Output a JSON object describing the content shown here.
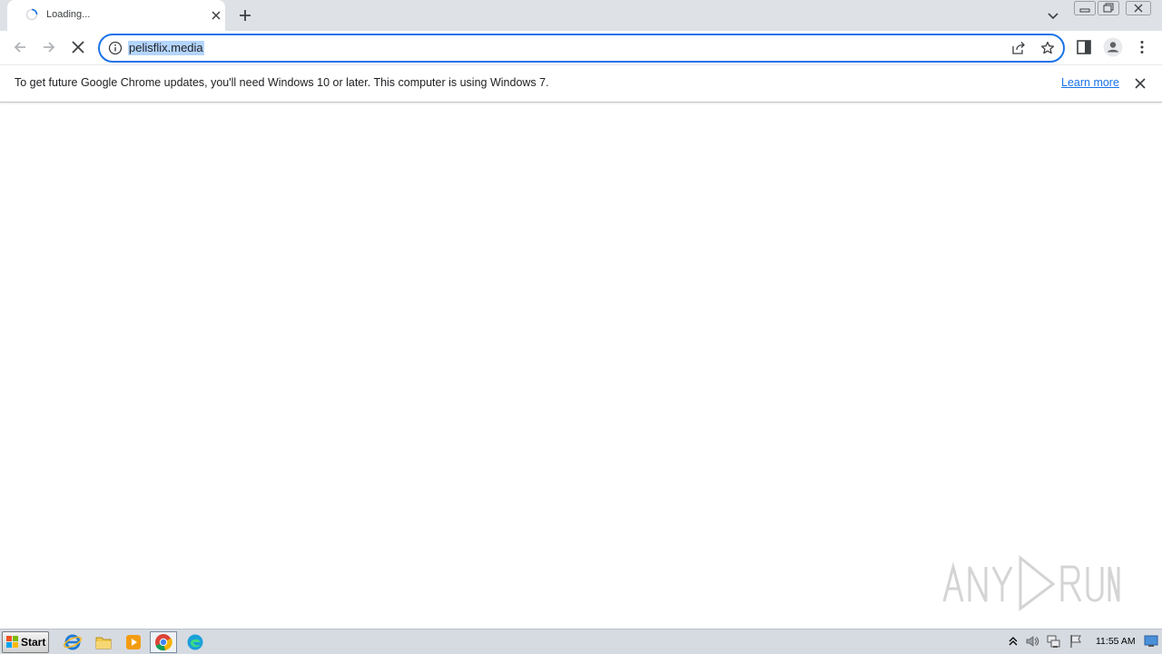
{
  "browser": {
    "tab": {
      "title": "Loading...",
      "spinner_icon": "loading-spinner-icon",
      "close_icon": "close-icon"
    },
    "new_tab_icon": "plus-icon",
    "tab_search_icon": "chevron-down-icon",
    "window_controls": [
      "minimize-icon",
      "restore-icon",
      "close-icon"
    ]
  },
  "toolbar": {
    "back_icon": "arrow-left-icon",
    "forward_icon": "arrow-right-icon",
    "stop_icon": "stop-loading-icon",
    "omnibox": {
      "url": "pelisflix.media",
      "info_icon": "info-icon",
      "share_icon": "share-icon",
      "bookmark_icon": "star-icon"
    },
    "side_panel_icon": "side-panel-icon",
    "profile_icon": "profile-icon",
    "menu_icon": "kebab-menu-icon"
  },
  "infobar": {
    "message": "To get future Google Chrome updates, you'll need Windows 10 or later. This computer is using Windows 7.",
    "link_label": "Learn more",
    "close_icon": "close-icon"
  },
  "watermark": {
    "text": "ANY RUN"
  },
  "taskbar": {
    "start_label": "Start",
    "apps": [
      "internet-explorer-icon",
      "folder-icon",
      "media-player-icon",
      "chrome-icon",
      "edge-icon"
    ],
    "tray_icons": [
      "show-hidden-icons-icon",
      "volume-icon",
      "network-icon",
      "action-center-flag-icon"
    ],
    "clock": "11:55 AM"
  },
  "colors": {
    "accent": "#1a73e8",
    "tabstrip": "#dee1e6",
    "url_selection": "#b4d5fe",
    "taskbar": "#d6dbe2"
  }
}
